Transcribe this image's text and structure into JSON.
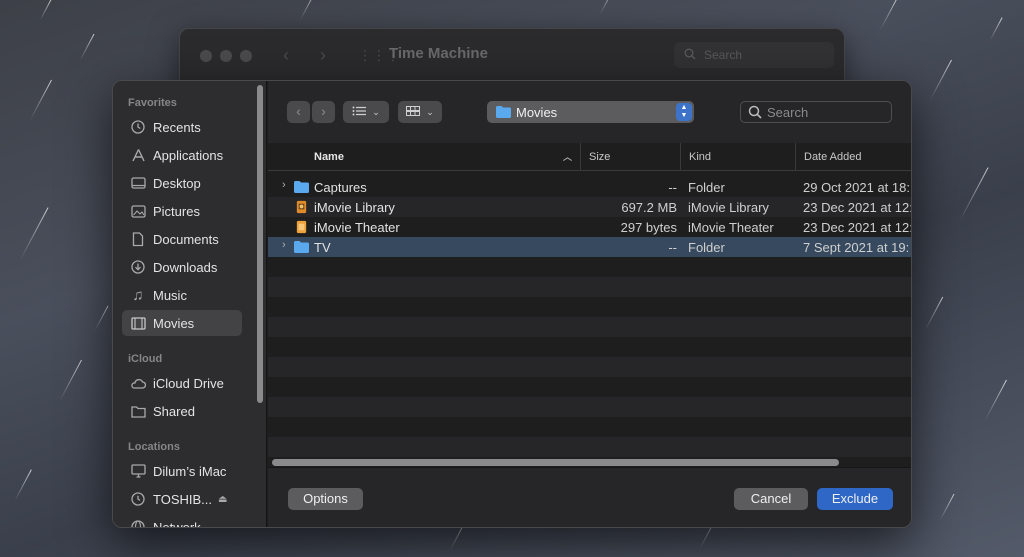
{
  "background_window": {
    "title": "Time Machine",
    "search_placeholder": "Search"
  },
  "sidebar": {
    "sections": [
      {
        "header": "Favorites",
        "items": [
          {
            "label": "Recents",
            "icon": "clock-icon"
          },
          {
            "label": "Applications",
            "icon": "applications-icon"
          },
          {
            "label": "Desktop",
            "icon": "desktop-icon"
          },
          {
            "label": "Pictures",
            "icon": "pictures-icon"
          },
          {
            "label": "Documents",
            "icon": "document-icon"
          },
          {
            "label": "Downloads",
            "icon": "download-icon"
          },
          {
            "label": "Music",
            "icon": "music-note-icon"
          },
          {
            "label": "Movies",
            "icon": "film-icon",
            "selected": true
          }
        ]
      },
      {
        "header": "iCloud",
        "items": [
          {
            "label": "iCloud Drive",
            "icon": "cloud-icon"
          },
          {
            "label": "Shared",
            "icon": "shared-folder-icon"
          }
        ]
      },
      {
        "header": "Locations",
        "items": [
          {
            "label": "Dilum’s iMac",
            "icon": "imac-icon"
          },
          {
            "label": "TOSHIB...",
            "icon": "time-machine-disk-icon"
          },
          {
            "label": "Network",
            "icon": "network-icon"
          }
        ]
      }
    ]
  },
  "toolbar": {
    "current_folder": "Movies",
    "search_placeholder": "Search"
  },
  "columns": {
    "name": "Name",
    "size": "Size",
    "kind": "Kind",
    "date_added": "Date Added"
  },
  "files": [
    {
      "name": "Captures",
      "size": "--",
      "kind": "Folder",
      "date": "29 Oct 2021 at 18:",
      "icon": "folder-icon",
      "expandable": true
    },
    {
      "name": "iMovie Library",
      "size": "697.2 MB",
      "kind": "iMovie Library",
      "date": "23 Dec 2021 at 12:",
      "icon": "imovie-library-icon",
      "expandable": false
    },
    {
      "name": "iMovie Theater",
      "size": "297 bytes",
      "kind": "iMovie Theater",
      "date": "23 Dec 2021 at 12:",
      "icon": "imovie-theater-icon",
      "expandable": false
    },
    {
      "name": "TV",
      "size": "--",
      "kind": "Folder",
      "date": "7 Sept 2021 at 19:",
      "icon": "folder-icon",
      "expandable": true,
      "selected": true
    }
  ],
  "buttons": {
    "options": "Options",
    "cancel": "Cancel",
    "exclude": "Exclude"
  },
  "colors": {
    "accent": "#2f67c7",
    "folder": "#5aa9ef",
    "selection": "#36495e"
  }
}
